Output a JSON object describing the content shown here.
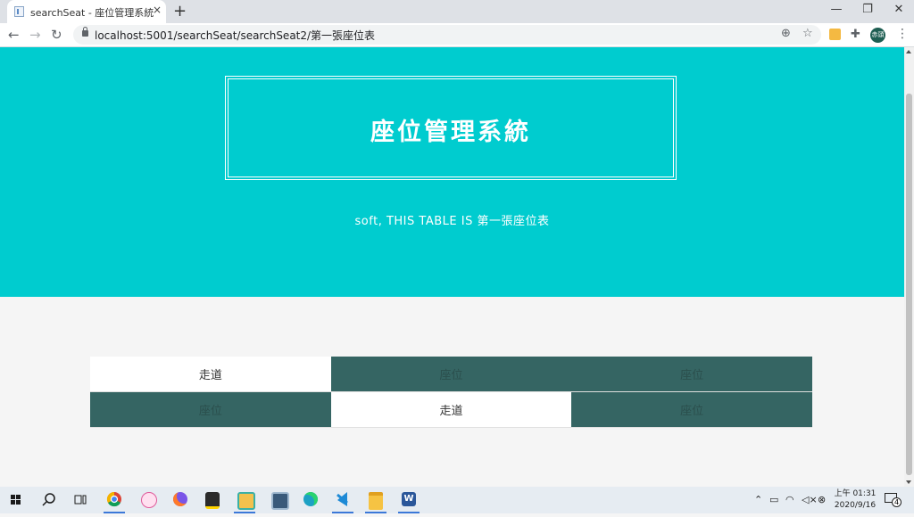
{
  "browser": {
    "tab_title": "searchSeat - 座位管理系統",
    "tab_close": "×",
    "new_tab": "+",
    "url": "localhost:5001/searchSeat/searchSeat2/第一張座位表",
    "window_controls": {
      "minimize": "—",
      "restore": "❐",
      "close": "✕"
    },
    "nav": {
      "back": "←",
      "forward": "→",
      "reload": "↻"
    },
    "profile_initials": "赤頭"
  },
  "page": {
    "title": "座位管理系統",
    "subtitle": "soft, THIS TABLE IS 第一張座位表",
    "seat_table": [
      [
        "走道",
        "座位",
        "座位"
      ],
      [
        "座位",
        "走道",
        "座位"
      ]
    ],
    "colors": {
      "hero": "#00cccf",
      "seat": "#356563",
      "walkway": "#ffffff"
    }
  },
  "taskbar": {
    "apps": [
      "windows-start",
      "search",
      "task-view",
      "chrome",
      "paint-3d",
      "firefox",
      "sticky-notes",
      "snip",
      "calculator",
      "edge",
      "vscode",
      "file-explorer",
      "word"
    ],
    "tray_time": "上午 01:31",
    "tray_date": "2020/9/16",
    "notification_count": "4"
  }
}
